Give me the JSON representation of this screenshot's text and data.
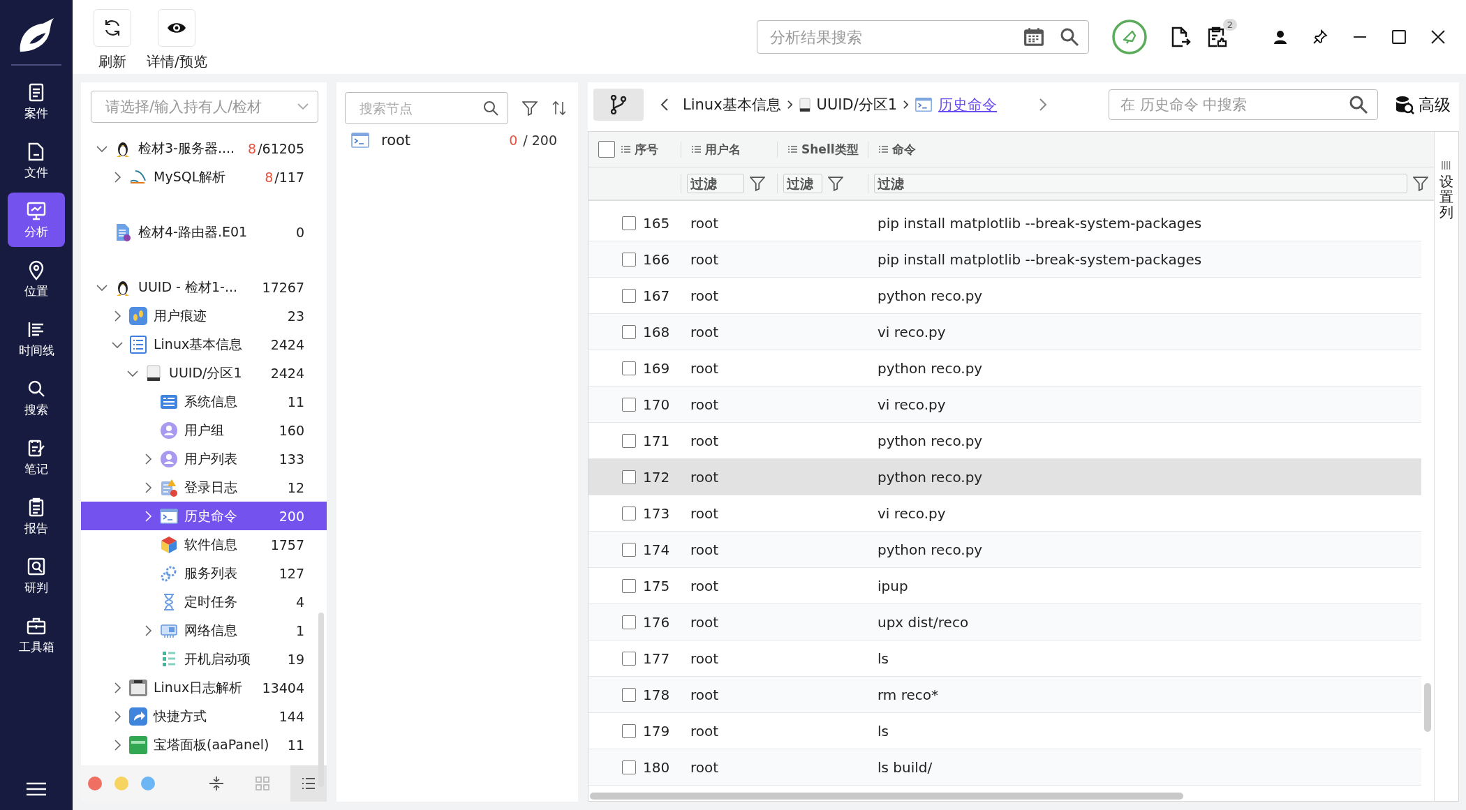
{
  "nav": [
    {
      "label": "案件",
      "kind": "case",
      "selected": false
    },
    {
      "label": "文件",
      "kind": "file",
      "selected": false
    },
    {
      "label": "分析",
      "kind": "analysis",
      "selected": true
    },
    {
      "label": "位置",
      "kind": "location",
      "selected": false
    },
    {
      "label": "时间线",
      "kind": "timeline",
      "selected": false
    },
    {
      "label": "搜索",
      "kind": "search",
      "selected": false
    },
    {
      "label": "笔记",
      "kind": "note",
      "selected": false
    },
    {
      "label": "报告",
      "kind": "report",
      "selected": false
    },
    {
      "label": "研判",
      "kind": "judge",
      "selected": false
    },
    {
      "label": "工具箱",
      "kind": "toolbox",
      "selected": false
    }
  ],
  "toolbar": {
    "buttons": [
      {
        "label": "刷新",
        "kind": "refresh"
      },
      {
        "label": "详情/预览",
        "kind": "preview"
      }
    ],
    "search": {
      "placeholder": "分析结果搜索"
    },
    "badge": "2"
  },
  "tree_panel": {
    "owner_select": {
      "placeholder": "请选择/输入持有人/检材"
    },
    "tree": [
      {
        "label": "检材3-服务器....",
        "count_flagged": "8",
        "count": "/61205",
        "kind": "linux",
        "expanded": true,
        "selected": false,
        "children": [
          {
            "label": "MySQL解析",
            "count_flagged": "8",
            "count": " /117",
            "kind": "mysql",
            "expanded": false,
            "selected": false
          }
        ]
      },
      {
        "label": "检材4-路由器.E01",
        "count": "0",
        "kind": "image-file",
        "selected": false
      },
      {
        "label": "UUID - 检材1-...",
        "count": "17267",
        "kind": "linux",
        "expanded": true,
        "selected": false,
        "children": [
          {
            "label": "用户痕迹",
            "count": "23",
            "kind": "footprints",
            "expanded": false,
            "selected": false
          },
          {
            "label": "Linux基本信息",
            "count": "2424",
            "kind": "list",
            "expanded": true,
            "selected": false,
            "children": [
              {
                "label": "UUID/分区1",
                "count": "2424",
                "kind": "disk",
                "expanded": true,
                "selected": false,
                "children": [
                  {
                    "label": "系统信息",
                    "count": "11",
                    "kind": "sysinfo",
                    "selected": false
                  },
                  {
                    "label": "用户组",
                    "count": "160",
                    "kind": "user",
                    "selected": false
                  },
                  {
                    "label": "用户列表",
                    "count": "133",
                    "kind": "user",
                    "expanded": false,
                    "selected": false
                  },
                  {
                    "label": "登录日志",
                    "count": "12",
                    "kind": "login-log",
                    "expanded": false,
                    "selected": false
                  },
                  {
                    "label": "历史命令",
                    "count": "200",
                    "kind": "terminal",
                    "expanded": false,
                    "selected": true
                  },
                  {
                    "label": "软件信息",
                    "count": "1757",
                    "kind": "cube",
                    "selected": false
                  },
                  {
                    "label": "服务列表",
                    "count": "127",
                    "kind": "gears",
                    "selected": false
                  },
                  {
                    "label": "定时任务",
                    "count": "4",
                    "kind": "hourglass",
                    "selected": false
                  },
                  {
                    "label": "网络信息",
                    "count": "1",
                    "kind": "network",
                    "expanded": false,
                    "selected": false
                  },
                  {
                    "label": "开机启动项",
                    "count": "19",
                    "kind": "startup",
                    "selected": false
                  }
                ]
              }
            ]
          },
          {
            "label": "Linux日志解析",
            "count": "13404",
            "kind": "log",
            "expanded": false,
            "selected": false
          },
          {
            "label": "快捷方式",
            "count": "144",
            "kind": "shortcut",
            "expanded": false,
            "selected": false
          },
          {
            "label": "宝塔面板(aaPanel)",
            "count": "11",
            "kind": "panel",
            "expanded": false,
            "selected": false
          }
        ]
      }
    ],
    "color_tags": [
      {
        "color": "#ef7062"
      },
      {
        "color": "#f7d45f"
      },
      {
        "color": "#6cb6f4"
      }
    ],
    "view_modes": [
      {
        "kind": "collapse",
        "selected": false
      },
      {
        "kind": "grid",
        "selected": false
      },
      {
        "kind": "list",
        "selected": true
      }
    ]
  },
  "node_panel": {
    "search": {
      "placeholder": "搜索节点"
    },
    "nodes": [
      {
        "label": "root",
        "flagged": "0",
        "total": " / 200"
      }
    ]
  },
  "results": {
    "breadcrumb": [
      {
        "label": "Linux基本信息",
        "kind": "text"
      },
      {
        "label": "UUID/分区1",
        "kind": "disk"
      },
      {
        "label": "历史命令",
        "kind": "current"
      }
    ],
    "search": {
      "placeholder": "在 历史命令 中搜索"
    },
    "advanced": "高级",
    "select_all_checked": false,
    "columns": [
      {
        "label": "序号"
      },
      {
        "label": "用户名",
        "filter": {
          "placeholder": "过滤"
        }
      },
      {
        "label": "Shell类型",
        "filter": {
          "placeholder": "过滤"
        }
      },
      {
        "label": "命令",
        "filter": {
          "placeholder": "过滤"
        }
      }
    ],
    "rows": [
      {
        "seq": "165",
        "user": "root",
        "command": "pip install matplotlib --break-system-packages",
        "checked": false,
        "selected": false
      },
      {
        "seq": "166",
        "user": "root",
        "command": "pip install matplotlib --break-system-packages",
        "checked": false,
        "selected": false
      },
      {
        "seq": "167",
        "user": "root",
        "command": "python reco.py",
        "checked": false,
        "selected": false
      },
      {
        "seq": "168",
        "user": "root",
        "command": "vi reco.py",
        "checked": false,
        "selected": false
      },
      {
        "seq": "169",
        "user": "root",
        "command": "python reco.py",
        "checked": false,
        "selected": false
      },
      {
        "seq": "170",
        "user": "root",
        "command": "vi reco.py",
        "checked": false,
        "selected": false
      },
      {
        "seq": "171",
        "user": "root",
        "command": "python reco.py",
        "checked": false,
        "selected": false
      },
      {
        "seq": "172",
        "user": "root",
        "command": "python reco.py",
        "checked": false,
        "selected": true
      },
      {
        "seq": "173",
        "user": "root",
        "command": "vi reco.py",
        "checked": false,
        "selected": false
      },
      {
        "seq": "174",
        "user": "root",
        "command": "python reco.py",
        "checked": false,
        "selected": false
      },
      {
        "seq": "175",
        "user": "root",
        "command": "ipup",
        "checked": false,
        "selected": false
      },
      {
        "seq": "176",
        "user": "root",
        "command": "upx dist/reco",
        "checked": false,
        "selected": false
      },
      {
        "seq": "177",
        "user": "root",
        "command": "ls",
        "checked": false,
        "selected": false
      },
      {
        "seq": "178",
        "user": "root",
        "command": "rm reco*",
        "checked": false,
        "selected": false
      },
      {
        "seq": "179",
        "user": "root",
        "command": "ls",
        "checked": false,
        "selected": false
      },
      {
        "seq": "180",
        "user": "root",
        "command": "ls build/",
        "checked": false,
        "selected": false
      }
    ],
    "column_settings": "设置列"
  }
}
